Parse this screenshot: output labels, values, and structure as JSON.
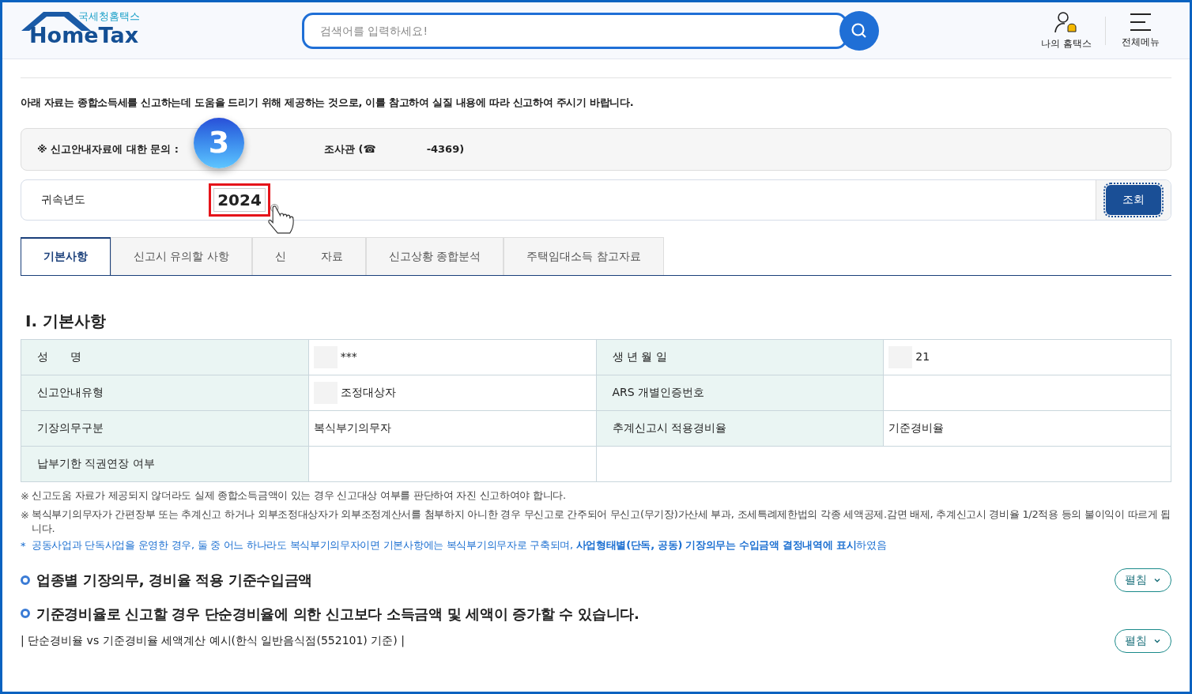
{
  "header": {
    "logo_sub": "국세청홈택스",
    "logo_main": "HomeTax",
    "search": {
      "placeholder": "검색어를 입력하세요!"
    },
    "my_label": "나의 홈택스",
    "menu_label": "전체메뉴"
  },
  "intro": "아래 자료는 종합소득세를 신고하는데 도움을 드리기 위해 제공하는 것으로, 이를 참고하여 실질 내용에 따라 신고하여 주시기 바랍니다.",
  "inquiry": {
    "label": "※ 신고안내자료에 대한 문의 :",
    "officer": "조사관 (☎",
    "phone": "-4369)"
  },
  "step_badge": "3",
  "year": {
    "label": "귀속년도",
    "value": "2024",
    "button": "조회"
  },
  "tabs": [
    {
      "label": "기본사항",
      "selected": true
    },
    {
      "label": "신고시 유의할 사항",
      "selected": false
    },
    {
      "label_start": "신",
      "label_end": "자료",
      "selected": false
    },
    {
      "label": "신고상황 종합분석",
      "selected": false
    },
    {
      "label": "주택임대소득 참고자료",
      "selected": false
    }
  ],
  "section_title": "Ⅰ. 기본사항",
  "table": {
    "rows": [
      [
        {
          "kind": "head",
          "text": "성　　명"
        },
        {
          "kind": "value",
          "text": "***",
          "masked": true
        },
        {
          "kind": "head",
          "text": "생 년 월 일"
        },
        {
          "kind": "value",
          "text": "21",
          "masked": true
        }
      ],
      [
        {
          "kind": "head",
          "text": "신고안내유형"
        },
        {
          "kind": "value",
          "text": "조정대상자",
          "masked": true
        },
        {
          "kind": "head",
          "text": "ARS 개별인증번호"
        },
        {
          "kind": "value",
          "text": ""
        }
      ],
      [
        {
          "kind": "head",
          "text": "기장의무구분"
        },
        {
          "kind": "value",
          "text": "복식부기의무자"
        },
        {
          "kind": "head",
          "text": "추계신고시 적용경비율"
        },
        {
          "kind": "value",
          "text": "기준경비율"
        }
      ],
      [
        {
          "kind": "head",
          "text": "납부기한 직권연장 여부"
        },
        {
          "kind": "value",
          "text": ""
        },
        {
          "kind": "wide",
          "text": ""
        }
      ]
    ]
  },
  "notes": [
    {
      "kind": "plain",
      "mark": "※",
      "text": "신고도움 자료가 제공되지 않더라도 실제 종합소득금액이 있는 경우 신고대상 여부를 판단하여 자진 신고하여야 합니다."
    },
    {
      "kind": "plain",
      "mark": "※",
      "text": "복식부기의무자가 간편장부 또는 추계신고 하거나 외부조정대상자가 외부조정계산서를 첨부하지 아니한 경우 무신고로 간주되어 무신고(무기장)가산세 부과, 조세특례제한법의 각종 세액공제.감면 배제, 추계신고시 경비율 1/2적용 등의 불이익이 따르게 됩니다."
    },
    {
      "kind": "blue",
      "mark": "*",
      "text": "공동사업과 단독사업을 운영한 경우, 둘 중 어느 하나라도 복식부기의무자이면 기본사항에는 복식부기의무자로 구축되며, **사업형태별(단독, 공동) 기장의무는 수입금액 결정내역에 표시**하였음"
    }
  ],
  "sections": [
    {
      "title": "업종별 기장의무, 경비율 적용 기준수입금액",
      "button": "펼침",
      "expanded": false
    },
    {
      "title": "기준경비율로 신고할 경우 단순경비율에 의한 신고보다 소득금액 및 세액이 증가할 수 있습니다.",
      "subtitle": "| 단순경비율 vs 기준경비율 세액계산 예시(한식 일반음식점(552101) 기준) |",
      "button": "펼침",
      "expanded": false
    }
  ]
}
